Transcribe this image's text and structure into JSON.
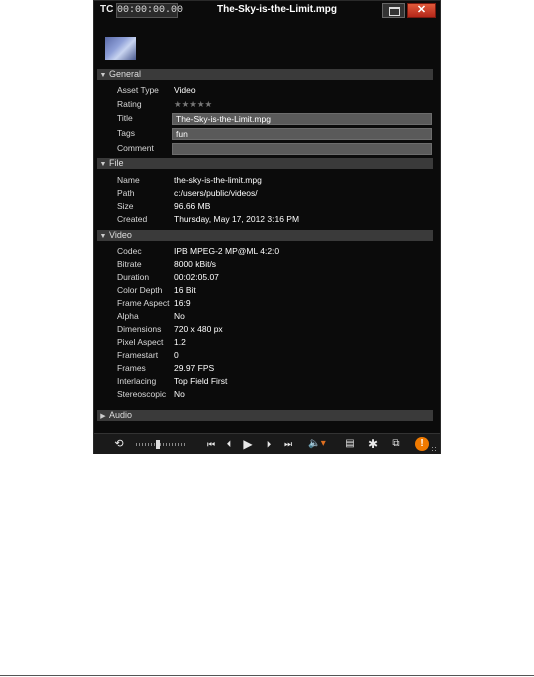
{
  "titlebar": {
    "tc_label": "TC",
    "timecode": "00:00:00.00",
    "title": "The-Sky-is-the-Limit.mpg",
    "close_glyph": "✕"
  },
  "sections": {
    "general": "General",
    "file": "File",
    "video": "Video",
    "audio": "Audio"
  },
  "general": {
    "asset_type": {
      "label": "Asset Type",
      "value": "Video"
    },
    "rating": {
      "label": "Rating",
      "value": "★★★★★"
    },
    "title": {
      "label": "Title",
      "value": "The-Sky-is-the-Limit.mpg"
    },
    "tags": {
      "label": "Tags",
      "value": "fun"
    },
    "comment": {
      "label": "Comment",
      "value": ""
    }
  },
  "file": {
    "name": {
      "label": "Name",
      "value": "the-sky-is-the-limit.mpg"
    },
    "path": {
      "label": "Path",
      "value": "c:/users/public/videos/"
    },
    "size": {
      "label": "Size",
      "value": "96.66 MB"
    },
    "created": {
      "label": "Created",
      "value": "Thursday, May 17, 2012 3:16 PM"
    }
  },
  "video": {
    "codec": {
      "label": "Codec",
      "value": "IPB MPEG-2  MP@ML 4:2:0"
    },
    "bitrate": {
      "label": "Bitrate",
      "value": "8000 kBit/s"
    },
    "duration": {
      "label": "Duration",
      "value": "00:02:05.07"
    },
    "color_depth": {
      "label": "Color Depth",
      "value": "16 Bit"
    },
    "frame_aspect": {
      "label": "Frame Aspect",
      "value": "16:9"
    },
    "alpha": {
      "label": "Alpha",
      "value": "No"
    },
    "dimensions": {
      "label": "Dimensions",
      "value": "720 x 480 px"
    },
    "pixel_aspect": {
      "label": "Pixel Aspect",
      "value": "1.2"
    },
    "framestart": {
      "label": "Framestart",
      "value": "0"
    },
    "frames": {
      "label": "Frames",
      "value": "29.97 FPS"
    },
    "interlacing": {
      "label": "Interlacing",
      "value": "Top Field First"
    },
    "stereoscopic": {
      "label": "Stereoscopic",
      "value": "No"
    }
  },
  "toolbar": {
    "loop_icon": "loop-icon",
    "skip_start_icon": "skip-to-start-icon",
    "step_back_icon": "step-back-icon",
    "play_icon": "play-icon",
    "step_forward_icon": "step-forward-icon",
    "skip_end_icon": "skip-to-end-icon",
    "volume_icon": "volume-icon",
    "info_glyph": "!"
  },
  "colors": {
    "window_bg": "#0b0b0b",
    "section_bg": "#3a3a3a",
    "field_bg": "#5a5a5a",
    "close_red": "#c8341f",
    "info_orange": "#f07a00",
    "volume_orange": "#e07020"
  }
}
